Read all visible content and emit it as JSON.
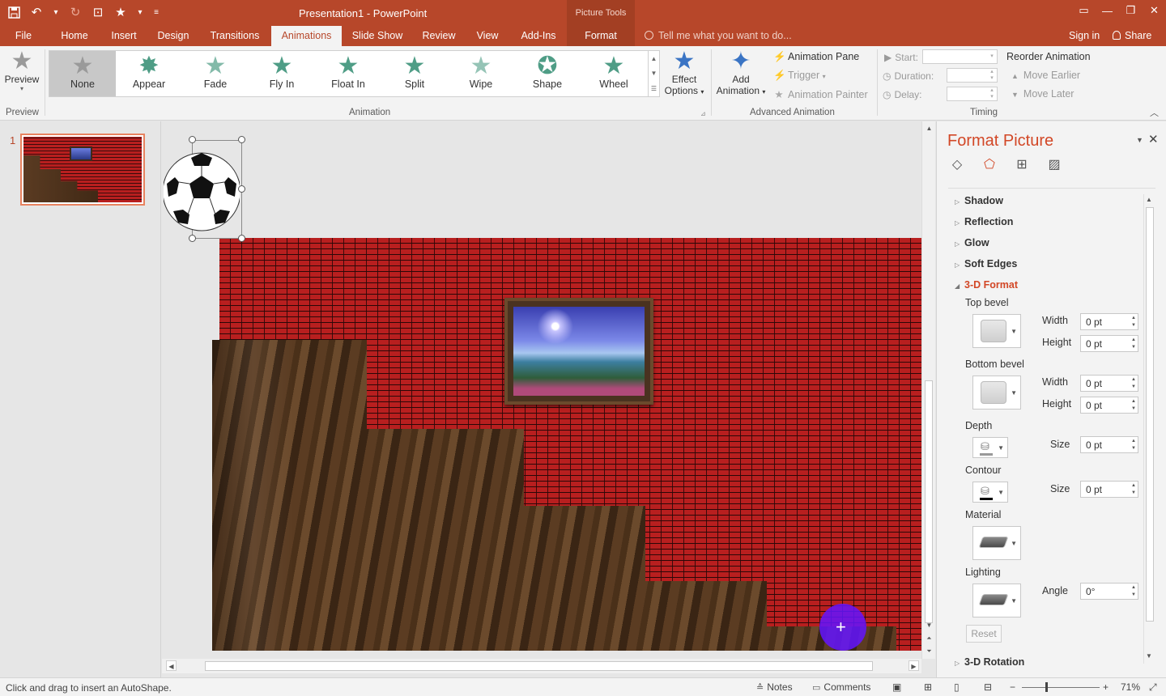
{
  "titlebar": {
    "app_title": "Presentation1 - PowerPoint",
    "context_header": "Picture Tools",
    "qat": {
      "save": "save-icon",
      "undo": "undo-icon",
      "redo": "redo-icon",
      "present": "present-icon",
      "star": "star-icon"
    },
    "win": {
      "ribbon_display": "▭",
      "minimize": "—",
      "restore": "❐",
      "close": "✕"
    }
  },
  "tabs": {
    "file": "File",
    "home": "Home",
    "insert": "Insert",
    "design": "Design",
    "transitions": "Transitions",
    "animations": "Animations",
    "slideshow": "Slide Show",
    "review": "Review",
    "view": "View",
    "addins": "Add-Ins",
    "format": "Format",
    "tellme": "Tell me what you want to do...",
    "signin": "Sign in",
    "share": "Share"
  },
  "ribbon": {
    "preview_label": "Preview",
    "preview_group": "Preview",
    "animation_group": "Animation",
    "advanced_group": "Advanced Animation",
    "timing_group": "Timing",
    "gallery": [
      {
        "label": "None"
      },
      {
        "label": "Appear"
      },
      {
        "label": "Fade"
      },
      {
        "label": "Fly In"
      },
      {
        "label": "Float In"
      },
      {
        "label": "Split"
      },
      {
        "label": "Wipe"
      },
      {
        "label": "Shape"
      },
      {
        "label": "Wheel"
      }
    ],
    "effect_options_1": "Effect",
    "effect_options_2": "Options",
    "add_animation_1": "Add",
    "add_animation_2": "Animation",
    "animation_pane": "Animation Pane",
    "trigger": "Trigger",
    "animation_painter": "Animation Painter",
    "start": "Start:",
    "duration": "Duration:",
    "delay": "Delay:",
    "reorder": "Reorder Animation",
    "move_earlier": "Move Earlier",
    "move_later": "Move Later"
  },
  "thumbs": {
    "number": "1"
  },
  "format_pane": {
    "title": "Format Picture",
    "sections": {
      "shadow": "Shadow",
      "reflection": "Reflection",
      "glow": "Glow",
      "soft_edges": "Soft Edges",
      "format3d": "3-D Format",
      "rotation3d": "3-D Rotation"
    },
    "top_bevel": "Top bevel",
    "bottom_bevel": "Bottom bevel",
    "depth": "Depth",
    "contour": "Contour",
    "material": "Material",
    "lighting": "Lighting",
    "width": "Width",
    "height": "Height",
    "size": "Size",
    "angle": "Angle",
    "top_width": "0 pt",
    "top_height": "0 pt",
    "bottom_width": "0 pt",
    "bottom_height": "0 pt",
    "depth_size": "0 pt",
    "contour_size": "0 pt",
    "angle_value": "0°",
    "reset": "Reset"
  },
  "status": {
    "message": "Click and drag to insert an AutoShape.",
    "notes": "Notes",
    "comments": "Comments",
    "zoom": "71%",
    "zoom_minus": "−",
    "zoom_plus": "+"
  }
}
